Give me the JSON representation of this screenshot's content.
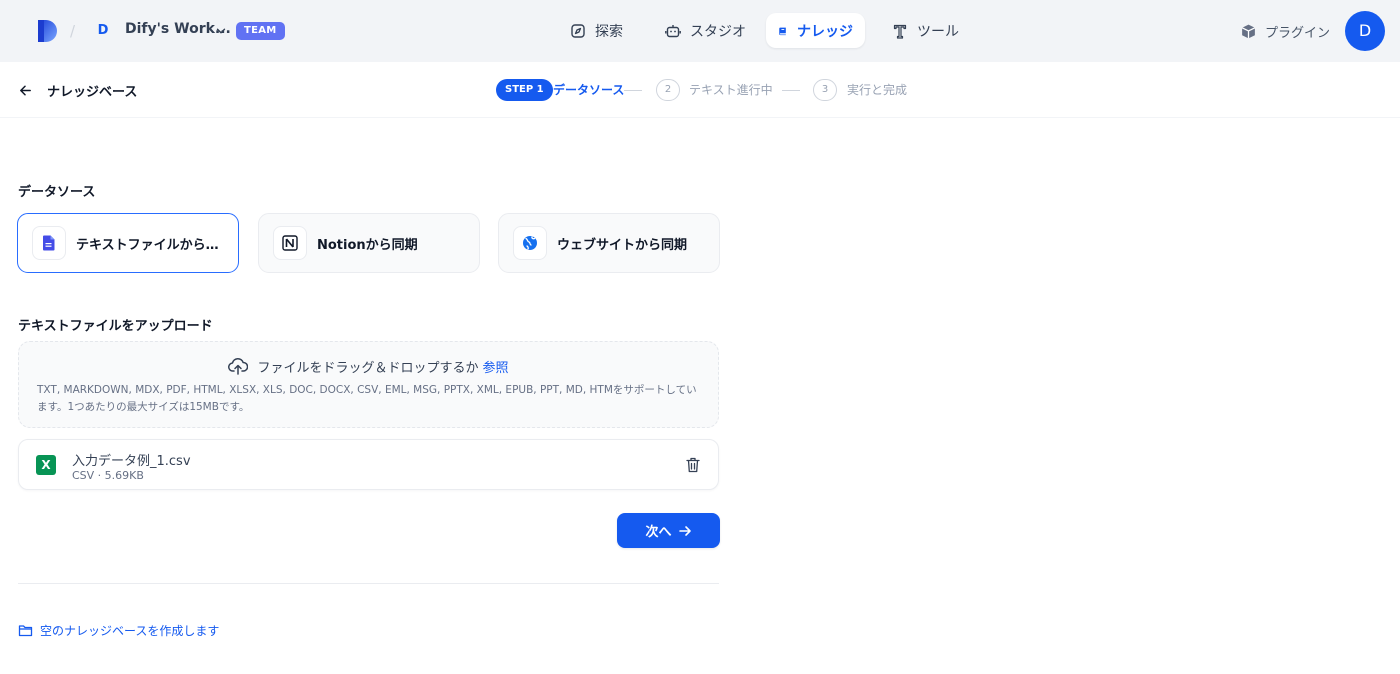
{
  "header": {
    "workspace_initial": "D",
    "workspace_name": "Dify's Work...",
    "team_badge": "TEAM",
    "nav": {
      "explore": "探索",
      "studio": "スタジオ",
      "knowledge": "ナレッジ",
      "tools": "ツール"
    },
    "plugins": "プラグイン",
    "avatar_initial": "D",
    "icons": {
      "logo": "dify-logo-icon",
      "explore": "compass-icon",
      "studio": "robot-icon",
      "knowledge": "book-icon",
      "tools": "tool-icon",
      "plugins": "cube-icon"
    }
  },
  "steps": {
    "back_label": "ナレッジベース",
    "step1_pill": "STEP 1",
    "step1_label": "データソース",
    "step2_num": "2",
    "step2_label": "テキスト進行中",
    "step3_num": "3",
    "step3_label": "実行と完成"
  },
  "datasource": {
    "title": "データソース",
    "options": [
      {
        "label": "テキストファイルからインポート",
        "icon": "document-icon",
        "selected": true
      },
      {
        "label": "Notionから同期",
        "icon": "notion-icon",
        "selected": false
      },
      {
        "label": "ウェブサイトから同期",
        "icon": "globe-icon",
        "selected": false
      }
    ]
  },
  "upload": {
    "title": "テキストファイルをアップロード",
    "drop_text": "ファイルをドラッグ＆ドロップするか",
    "browse_link": "参照",
    "hint": "TXT, MARKDOWN, MDX, PDF, HTML, XLSX, XLS, DOC, DOCX, CSV, EML, MSG, PPTX, XML, EPUB, PPT, MD, HTMをサポートしています。1つあたりの最大サイズは15MBです。"
  },
  "files": [
    {
      "name": "入力データ例_1.csv",
      "meta": "CSV · 5.69KB",
      "icon_letter": "X"
    }
  ],
  "actions": {
    "next": "次へ",
    "create_empty": "空のナレッジベースを作成します"
  },
  "colors": {
    "accent": "#155aef",
    "topbar_bg": "#f2f4f7",
    "team_badge": "#6172f3",
    "excel_green": "#079455"
  }
}
